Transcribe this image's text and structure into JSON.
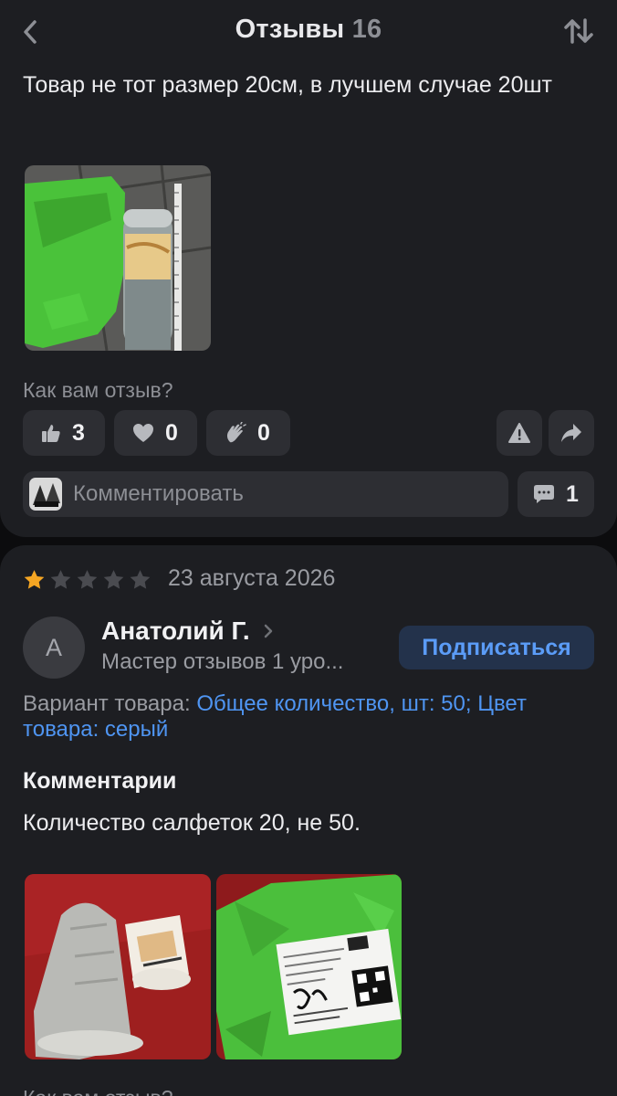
{
  "header": {
    "title": "Отзывы",
    "count": "16"
  },
  "review1": {
    "text": "Товар не тот размер 20см, в лучшем случае 20шт",
    "helpful_question": "Как вам отзыв?",
    "likes": "3",
    "hearts": "0",
    "claps": "0",
    "comment_placeholder": "Комментировать",
    "comment_count": "1"
  },
  "review2": {
    "rating": 1,
    "rating_max": 5,
    "date": "23 августа 2026",
    "avatar_letter": "А",
    "author": "Анатолий Г.",
    "author_rank": "Мастер отзывов 1 уро...",
    "subscribe_label": "Подписаться",
    "variant_label": "Вариант товара:",
    "variant_value": "Общее количество, шт: 50; Цвет товара: серый",
    "comments_title": "Комментарии",
    "comment_text": "Количество салфеток 20, не 50.",
    "helpful_question": "Как вам отзыв?"
  },
  "colors": {
    "background": "#0c0c0e",
    "card": "#1d1e22",
    "button": "#2d2e33",
    "accent_blue": "#4f95f2",
    "star_active": "#f5a623",
    "star_inactive": "#4a4b50"
  },
  "icons": [
    "back-chevron-icon",
    "sort-icon",
    "thumbs-up-icon",
    "heart-icon",
    "clap-icon",
    "warning-icon",
    "share-icon",
    "comment-bubble-icon",
    "star-icon",
    "chevron-right-icon"
  ]
}
